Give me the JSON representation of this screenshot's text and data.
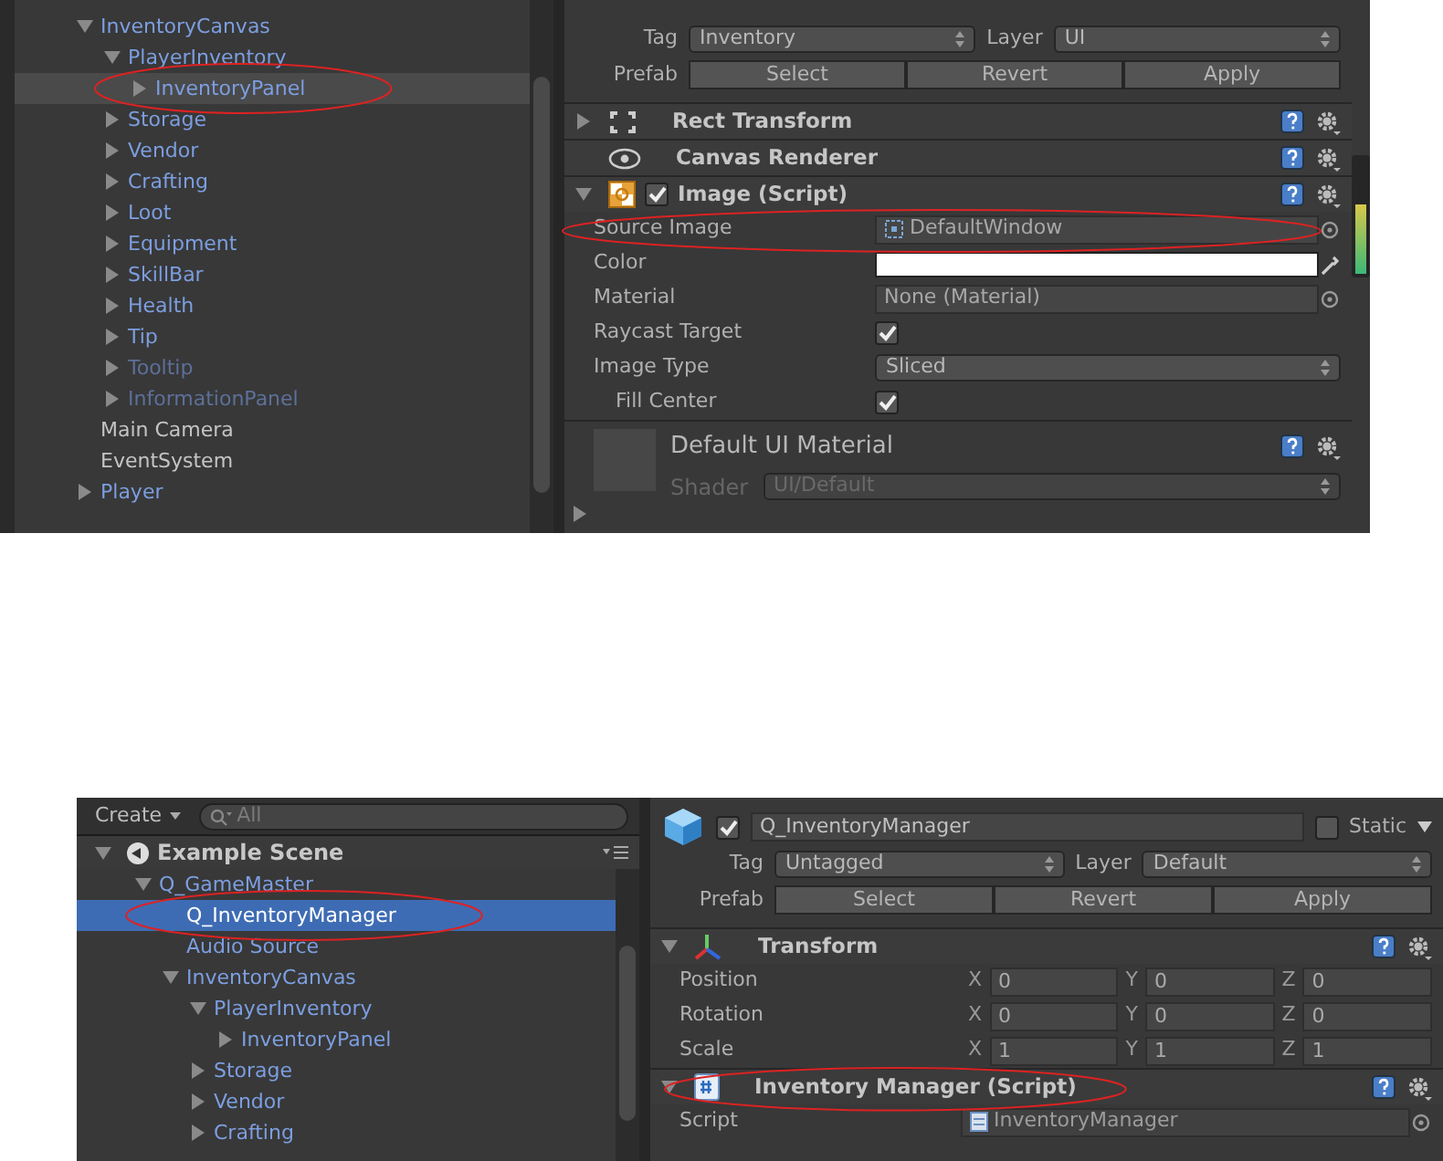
{
  "screenshots": [
    {
      "hierarchy": {
        "items": [
          {
            "label": "InventoryCanvas",
            "kind": "prefab",
            "expanded": true,
            "selected": false,
            "children": [
              {
                "label": "PlayerInventory",
                "kind": "prefab",
                "expanded": true,
                "selected": false,
                "children": [
                  {
                    "label": "InventoryPanel",
                    "kind": "prefab",
                    "expanded": false,
                    "selected": true,
                    "circled": true
                  }
                ]
              },
              {
                "label": "Storage",
                "kind": "prefab",
                "expanded": false,
                "selected": false
              },
              {
                "label": "Vendor",
                "kind": "prefab",
                "expanded": false,
                "selected": false
              },
              {
                "label": "Crafting",
                "kind": "prefab",
                "expanded": false,
                "selected": false
              },
              {
                "label": "Loot",
                "kind": "prefab",
                "expanded": false,
                "selected": false
              },
              {
                "label": "Equipment",
                "kind": "prefab",
                "expanded": false,
                "selected": false
              },
              {
                "label": "SkillBar",
                "kind": "prefab",
                "expanded": false,
                "selected": false
              },
              {
                "label": "Health",
                "kind": "prefab",
                "expanded": false,
                "selected": false
              },
              {
                "label": "Tip",
                "kind": "prefab",
                "expanded": false,
                "selected": false
              },
              {
                "label": "Tooltip",
                "kind": "inactive_prefab",
                "expanded": false,
                "selected": false
              },
              {
                "label": "InformationPanel",
                "kind": "inactive_prefab",
                "expanded": false,
                "selected": false
              }
            ]
          },
          {
            "label": "Main Camera",
            "kind": "object",
            "selected": false
          },
          {
            "label": "EventSystem",
            "kind": "object",
            "selected": false
          },
          {
            "label": "Player",
            "kind": "prefab",
            "expanded": false,
            "selected": false
          }
        ]
      },
      "inspector": {
        "tag": {
          "label": "Tag",
          "value": "Inventory"
        },
        "layer": {
          "label": "Layer",
          "value": "UI"
        },
        "prefab": {
          "label": "Prefab",
          "buttons": [
            "Select",
            "Revert",
            "Apply"
          ]
        },
        "components": [
          {
            "kind": "rect_transform",
            "title": "Rect Transform",
            "expanded": false
          },
          {
            "kind": "canvas_renderer",
            "title": "Canvas Renderer"
          },
          {
            "kind": "image",
            "title": "Image (Script)",
            "expanded": true,
            "enabled": true,
            "properties": [
              {
                "kind": "sprite_object",
                "label": "Source Image",
                "value": "DefaultWindow",
                "circled": true
              },
              {
                "kind": "color",
                "label": "Color",
                "color": "#ffffff"
              },
              {
                "kind": "object",
                "label": "Material",
                "value": "None (Material)"
              },
              {
                "kind": "checkbox",
                "label": "Raycast Target",
                "checked": true
              },
              {
                "kind": "dropdown",
                "label": "Image Type",
                "value": "Sliced",
                "children": [
                  {
                    "kind": "checkbox",
                    "label": "Fill Center",
                    "checked": true
                  }
                ]
              }
            ]
          },
          {
            "kind": "material",
            "title": "Default UI Material",
            "expanded": false,
            "properties": [
              {
                "kind": "dropdown",
                "label": "Shader",
                "value": "UI/Default",
                "disabled": true
              }
            ]
          }
        ]
      }
    },
    {
      "hierarchy": {
        "create_button": "Create",
        "search": {
          "placeholder": "All"
        },
        "scene": {
          "name": "Example Scene",
          "expanded": true
        },
        "items": [
          {
            "label": "Q_GameMaster",
            "kind": "prefab",
            "expanded": true,
            "selected": false,
            "children": [
              {
                "label": "Q_InventoryManager",
                "kind": "prefab",
                "selected": true,
                "circled": true
              },
              {
                "label": "Audio Source",
                "kind": "prefab",
                "selected": false
              },
              {
                "label": "InventoryCanvas",
                "kind": "prefab",
                "expanded": true,
                "selected": false,
                "children": [
                  {
                    "label": "PlayerInventory",
                    "kind": "prefab",
                    "expanded": true,
                    "selected": false,
                    "children": [
                      {
                        "label": "InventoryPanel",
                        "kind": "prefab",
                        "expanded": false,
                        "selected": false
                      }
                    ]
                  },
                  {
                    "label": "Storage",
                    "kind": "prefab",
                    "expanded": false,
                    "selected": false
                  },
                  {
                    "label": "Vendor",
                    "kind": "prefab",
                    "expanded": false,
                    "selected": false
                  },
                  {
                    "label": "Crafting",
                    "kind": "prefab",
                    "expanded": false,
                    "selected": false
                  }
                ]
              }
            ]
          }
        ]
      },
      "inspector": {
        "header": {
          "active": true,
          "name": "Q_InventoryManager",
          "static": {
            "label": "Static",
            "checked": false
          }
        },
        "tag": {
          "label": "Tag",
          "value": "Untagged"
        },
        "layer": {
          "label": "Layer",
          "value": "Default"
        },
        "prefab": {
          "label": "Prefab",
          "buttons": [
            "Select",
            "Revert",
            "Apply"
          ]
        },
        "components": [
          {
            "kind": "transform",
            "title": "Transform",
            "expanded": true,
            "properties": [
              {
                "kind": "vector",
                "label": "Position",
                "fields": [
                  {
                    "axis": "X",
                    "value": "0"
                  },
                  {
                    "axis": "Y",
                    "value": "0"
                  },
                  {
                    "axis": "Z",
                    "value": "0"
                  }
                ]
              },
              {
                "kind": "vector",
                "label": "Rotation",
                "fields": [
                  {
                    "axis": "X",
                    "value": "0"
                  },
                  {
                    "axis": "Y",
                    "value": "0"
                  },
                  {
                    "axis": "Z",
                    "value": "0"
                  }
                ]
              },
              {
                "kind": "vector",
                "label": "Scale",
                "fields": [
                  {
                    "axis": "X",
                    "value": "1"
                  },
                  {
                    "axis": "Y",
                    "value": "1"
                  },
                  {
                    "axis": "Z",
                    "value": "1"
                  }
                ]
              }
            ]
          },
          {
            "kind": "script",
            "title": "Inventory Manager (Script)",
            "expanded": true,
            "circled": true,
            "properties": [
              {
                "kind": "script_object",
                "label": "Script",
                "value": "InventoryManager",
                "disabled": true
              }
            ]
          }
        ]
      }
    }
  ]
}
